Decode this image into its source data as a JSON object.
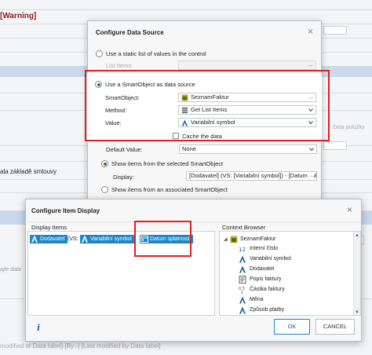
{
  "background": {
    "warning_text": "[Warning]",
    "left_label": "ala základě smlouvy",
    "cut_text": "ajte data",
    "bottom_text": "modified or Data label]-[By:-] [Last modified by Data label]",
    "right_text": "Data položky"
  },
  "data_source_dialog": {
    "title": "Configure Data Source",
    "close_icon": "×",
    "static_option_label": "Use a static list of values in the control",
    "list_items_label": "List Items:",
    "list_items_button": "...",
    "smartobject_option_label": "Use a SmartObject as data source",
    "smartobject_label": "SmartObject:",
    "smartobject_value": "SeznamFaktur",
    "smartobject_button": "...",
    "method_label": "Method:",
    "method_value": "Get List Items",
    "value_label": "Value:",
    "value_value": "Variabilní symbol",
    "cache_label": "Cache the data",
    "default_value_label": "Default Value:",
    "default_value_value": "None",
    "show_selected_label": "Show items from the selected SmartObject",
    "display_label": "Display:",
    "display_value": "[Dodavatel] (VS: [Variabilní symbol]) - [Datum spl",
    "display_button": "...",
    "show_associated_label": "Show items from an associated SmartObject"
  },
  "item_display_dialog": {
    "title": "Configure Item Display",
    "close_icon": "×",
    "display_items_label": "Display Items",
    "context_browser_label": "Context Browser",
    "tokens": {
      "dodavatel": "Dodavatel",
      "vs_open": "(VS:",
      "variabilni": "Variabilní symbol",
      "datum": "Datum splatnosti"
    },
    "tree": {
      "root": "SeznamFaktur",
      "items": [
        {
          "label": "Interní číslo",
          "icon": "number-icon"
        },
        {
          "label": "Variabilní symbol",
          "icon": "text-icon"
        },
        {
          "label": "Dodavatel",
          "icon": "text-icon"
        },
        {
          "label": "Popis faktury",
          "icon": "memo-icon"
        },
        {
          "label": "Částka faktury",
          "icon": "decimal-icon"
        },
        {
          "label": "Měna",
          "icon": "text-icon"
        },
        {
          "label": "Způsob platby",
          "icon": "text-icon"
        }
      ]
    },
    "ok_label": "OK",
    "cancel_label": "CANCEL"
  },
  "colors": {
    "accent_blue": "#1c86c8",
    "highlight_red": "#e02020",
    "smartobject_green": "#2e7d32"
  }
}
